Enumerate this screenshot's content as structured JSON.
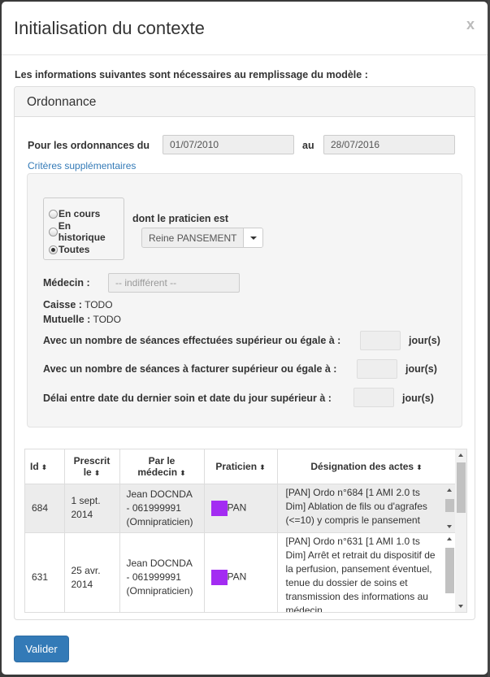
{
  "modal": {
    "title": "Initialisation du contexte",
    "close": "x",
    "intro": "Les informations suivantes sont nécessaires au remplissage du modèle :"
  },
  "panel": {
    "heading": "Ordonnance",
    "date_label_from": "Pour les ordonnances du",
    "date_from": "01/07/2010",
    "date_label_to": "au",
    "date_to": "28/07/2016",
    "criteria_link": "Critères supplémentaires"
  },
  "criteria": {
    "radios": [
      {
        "label": "En cours",
        "checked": false
      },
      {
        "label": "En historique",
        "checked": false
      },
      {
        "label": "Toutes",
        "checked": true
      }
    ],
    "practitioner_label": "dont le praticien est",
    "practitioner_value": "Reine PANSEMENT",
    "medecin_label": "Médecin :",
    "medecin_placeholder": "-- indifférent --",
    "caisse_label": "Caisse :",
    "caisse_value": "TODO",
    "mutuelle_label": "Mutuelle :",
    "mutuelle_value": "TODO",
    "seances_effectuees_label": "Avec un nombre de séances effectuées supérieur ou égale à :",
    "seances_facturer_label": "Avec un nombre de séances à facturer supérieur ou égale à :",
    "delai_label": "Délai entre date du dernier soin et date du jour supérieur à :",
    "unit": "jour(s)"
  },
  "table": {
    "headers": {
      "id": "Id",
      "prescrit": "Prescrit le",
      "par": "Par le médecin",
      "praticien": "Praticien",
      "designation": "Désignation des actes"
    },
    "sort_icon": "⬍",
    "rows": [
      {
        "id": "684",
        "prescrit": "1 sept. 2014",
        "medecin": "Jean DOCNDA - 061999991 (Omnipraticien)",
        "praticien": "PAN",
        "color": "#a32cf2",
        "designation": "[PAN] Ordo n°684 [1 AMI 2.0 ts Dim] Ablation de fils ou d'agrafes (<=10) y compris le pansement"
      },
      {
        "id": "631",
        "prescrit": "25 avr. 2014",
        "medecin": "Jean DOCNDA - 061999991 (Omnipraticien)",
        "praticien": "PAN",
        "color": "#a32cf2",
        "designation": "[PAN] Ordo n°631 [1 AMI 1.0 ts Dim] Arrêt et retrait du dispositif de la perfusion, pansement éventuel, tenue du dossier de soins et transmission des informations au médecin"
      }
    ]
  },
  "footer": {
    "submit": "Valider"
  }
}
